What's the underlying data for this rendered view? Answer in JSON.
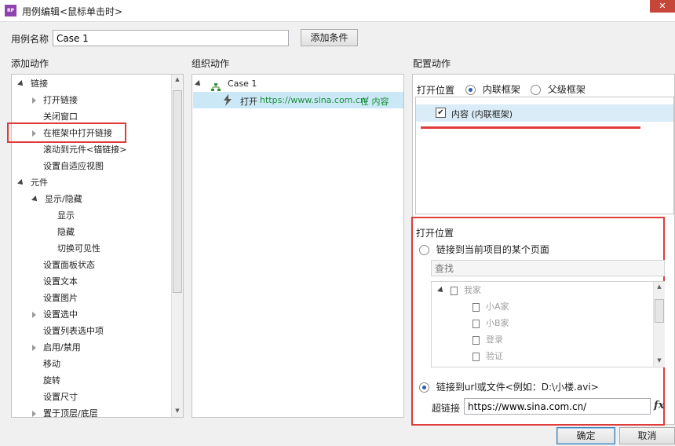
{
  "window": {
    "app_icon": "RP",
    "title": "用例编辑<鼠标单击时>",
    "close_label": "✕"
  },
  "case_name": {
    "label": "用例名称",
    "value": "Case 1",
    "add_condition_label": "添加条件"
  },
  "add_actions": {
    "heading": "添加动作",
    "items": [
      {
        "label": "链接",
        "arrow": "expanded"
      },
      {
        "label": "打开链接",
        "arrow": "collapsed"
      },
      {
        "label": "关闭窗口",
        "arrow": "none"
      },
      {
        "label": "在框架中打开链接",
        "arrow": "collapsed"
      },
      {
        "label": "滚动到元件<锚链接>",
        "arrow": "none"
      },
      {
        "label": "设置自适应视图",
        "arrow": "none"
      },
      {
        "label": "元件",
        "arrow": "expanded"
      },
      {
        "label": "显示/隐藏",
        "arrow": "expanded"
      },
      {
        "label": "显示",
        "arrow": "none"
      },
      {
        "label": "隐藏",
        "arrow": "none"
      },
      {
        "label": "切换可见性",
        "arrow": "none"
      },
      {
        "label": "设置面板状态",
        "arrow": "none"
      },
      {
        "label": "设置文本",
        "arrow": "none"
      },
      {
        "label": "设置图片",
        "arrow": "none"
      },
      {
        "label": "设置选中",
        "arrow": "collapsed"
      },
      {
        "label": "设置列表选中项",
        "arrow": "none"
      },
      {
        "label": "启用/禁用",
        "arrow": "collapsed"
      },
      {
        "label": "移动",
        "arrow": "none"
      },
      {
        "label": "旋转",
        "arrow": "none"
      },
      {
        "label": "设置尺寸",
        "arrow": "none"
      },
      {
        "label": "置于顶层/底层",
        "arrow": "collapsed"
      }
    ]
  },
  "organize_actions": {
    "heading": "组织动作",
    "case_label": "Case 1",
    "action_prefix": "打开",
    "action_url": "https://www.sina.com.cn/",
    "action_suffix": "在 内容"
  },
  "configure_actions": {
    "heading": "配置动作",
    "open_in_label": "打开位置",
    "radio_inline": "内联框架",
    "radio_parent": "父级框架",
    "frame_item": "内容 (内联框架)",
    "section_label": "打开位置",
    "link_page_label": "链接到当前项目的某个页面",
    "search_placeholder": "查找",
    "pages": [
      {
        "label": "我家",
        "level": 0,
        "arrow": "expanded"
      },
      {
        "label": "小A家",
        "level": 1,
        "arrow": "none"
      },
      {
        "label": "小B家",
        "level": 1,
        "arrow": "none"
      },
      {
        "label": "登录",
        "level": 1,
        "arrow": "none"
      },
      {
        "label": "验证",
        "level": 1,
        "arrow": "none"
      }
    ],
    "link_url_label": "链接到url或文件<例如：D:\\小楼.avi>",
    "hyperlink_label": "超链接",
    "hyperlink_value": "https://www.sina.com.cn/",
    "fx_label": "fx"
  },
  "footer": {
    "ok_label": "确定",
    "cancel_label": "取消"
  },
  "colors": {
    "highlight": "#d9ecf7",
    "selected_row": "#cbe8f6",
    "annotation": "#e03b3b",
    "url_green": "#1a8f3a"
  }
}
